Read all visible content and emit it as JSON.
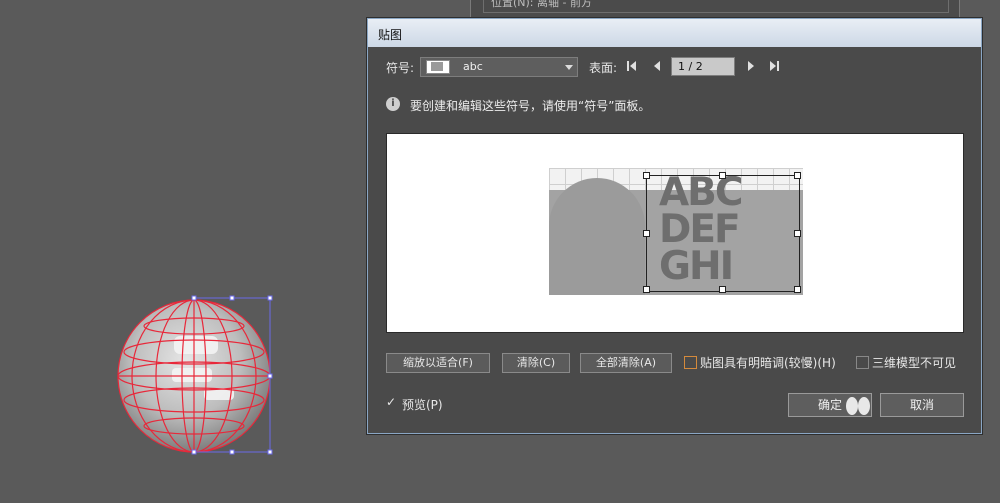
{
  "background_panel": {
    "text": "位置(N): 离轴 - 前方"
  },
  "dialog": {
    "title": "贴图",
    "symbol_label": "符号:",
    "symbol_value": "abc",
    "surface_label": "表面:",
    "surface_value": "1 / 2",
    "info_text": "要创建和编辑这些符号，请使用“符号”面板。",
    "artwork_lines": [
      "ABC",
      "DEF",
      "GHI"
    ],
    "buttons": {
      "scale_to_fit": "缩放以适合(F)",
      "clear": "清除(C)",
      "clear_all": "全部清除(A)",
      "ok": "确定",
      "cancel": "取消"
    },
    "options": {
      "shade_artwork": {
        "label": "贴图具有明暗调(较慢)(H)",
        "checked": false
      },
      "invisible_geometry": {
        "label": "三维模型不可见",
        "checked": false
      },
      "preview": {
        "label": "预览(P)",
        "checked": true
      }
    }
  },
  "colors": {
    "selection": "#e8283a",
    "bounding_box": "#6a6ae8",
    "dialog_bg": "#4a4a4a",
    "titlebar": "#dfe6ef"
  },
  "icons": [
    "info-icon",
    "first-surface-icon",
    "prev-surface-icon",
    "next-surface-icon",
    "last-surface-icon",
    "dropdown-arrow-icon"
  ]
}
